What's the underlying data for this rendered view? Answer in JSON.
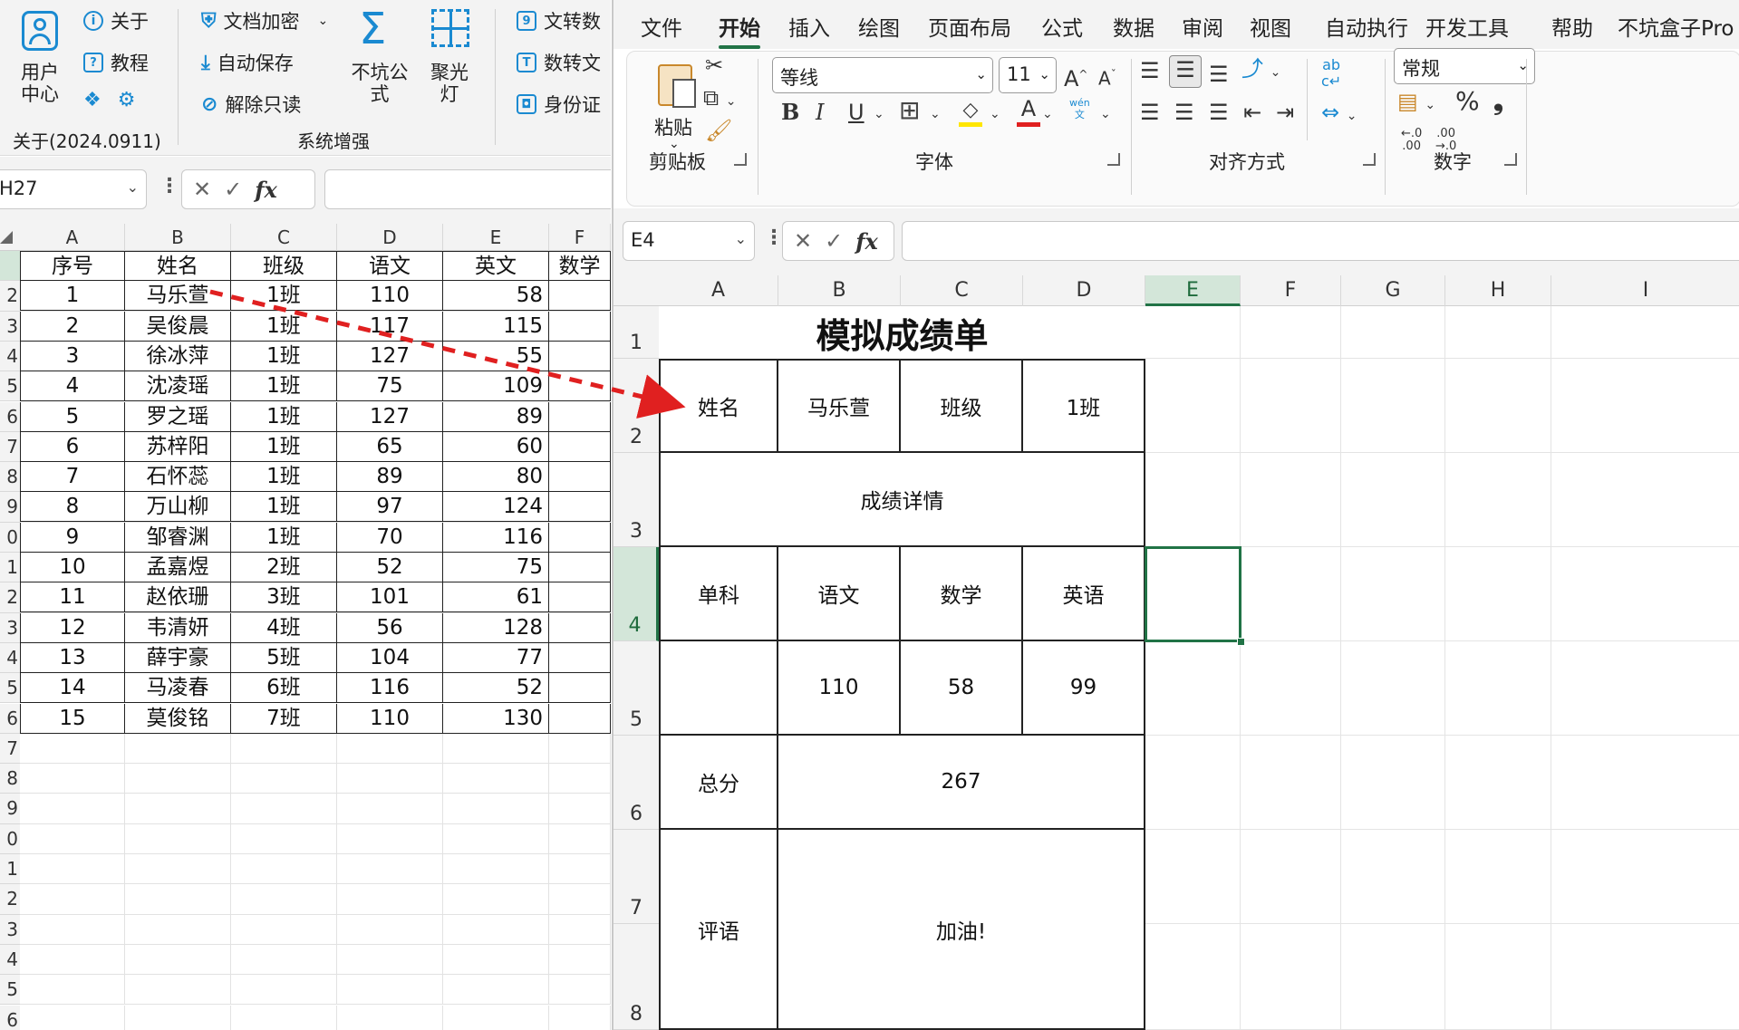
{
  "left_window": {
    "ribbon": {
      "user_center": "用户\n中心",
      "about": "关于",
      "tutorial": "教程",
      "doc_encrypt": "文档加密",
      "auto_save": "自动保存",
      "unlock_readonly": "解除只读",
      "bukeng_formula": "不坑公\n式",
      "spotlight": "聚光\n灯",
      "text_convert": "文转数",
      "num_convert": "数转文",
      "id_card": "身份证",
      "version_label": "关于(2024.0911)",
      "system_group": "系统增强"
    },
    "name_box": "H27",
    "column_headers": [
      "A",
      "B",
      "C",
      "D",
      "E",
      "F"
    ],
    "row_numbers": [
      "2",
      "3",
      "4",
      "5",
      "6",
      "7",
      "8",
      "9",
      "0",
      "1",
      "2",
      "3",
      "4",
      "5",
      "6",
      "7",
      "8",
      "9",
      "0",
      "1",
      "2",
      "3",
      "4",
      "5",
      "6"
    ],
    "table_headers": [
      "序号",
      "姓名",
      "班级",
      "语文",
      "英文",
      "数学"
    ],
    "rows": [
      [
        "1",
        "马乐萱",
        "1班",
        "110",
        "58"
      ],
      [
        "2",
        "吴俊晨",
        "1班",
        "117",
        "115"
      ],
      [
        "3",
        "徐冰萍",
        "1班",
        "127",
        "55"
      ],
      [
        "4",
        "沈凌瑶",
        "1班",
        "75",
        "109"
      ],
      [
        "5",
        "罗之瑶",
        "1班",
        "127",
        "89"
      ],
      [
        "6",
        "苏梓阳",
        "1班",
        "65",
        "60"
      ],
      [
        "7",
        "石怀蕊",
        "1班",
        "89",
        "80"
      ],
      [
        "8",
        "万山柳",
        "1班",
        "97",
        "124"
      ],
      [
        "9",
        "邹睿渊",
        "1班",
        "70",
        "116"
      ],
      [
        "10",
        "孟嘉煜",
        "2班",
        "52",
        "75"
      ],
      [
        "11",
        "赵依珊",
        "3班",
        "101",
        "61"
      ],
      [
        "12",
        "韦清妍",
        "4班",
        "56",
        "128"
      ],
      [
        "13",
        "薛宇豪",
        "5班",
        "104",
        "77"
      ],
      [
        "14",
        "马凌春",
        "6班",
        "116",
        "52"
      ],
      [
        "15",
        "莫俊铭",
        "7班",
        "110",
        "130"
      ]
    ]
  },
  "right_window": {
    "menu_tabs": [
      "文件",
      "开始",
      "插入",
      "绘图",
      "页面布局",
      "公式",
      "数据",
      "审阅",
      "视图",
      "自动执行",
      "开发工具",
      "帮助",
      "不坑盒子Pro"
    ],
    "active_tab": "开始",
    "ribbon": {
      "paste": "粘贴",
      "clipboard_group": "剪贴板",
      "font_name": "等线",
      "font_size": "11",
      "font_group": "字体",
      "align_group": "对齐方式",
      "number_format": "常规",
      "number_group": "数字",
      "bold": "B",
      "italic": "I",
      "underline": "U",
      "percent": "%",
      "comma": "❟",
      "wen": "wén\n文",
      "dec_inc": "←.0\n.00",
      "dec_dec": ".00\n→.0"
    },
    "name_box": "E4",
    "column_headers": [
      "A",
      "B",
      "C",
      "D",
      "E",
      "F",
      "G",
      "H",
      "I"
    ],
    "row_numbers": [
      "1",
      "2",
      "3",
      "4",
      "5",
      "6",
      "7",
      "8"
    ],
    "selected_cell": "E4",
    "report": {
      "title": "模拟成绩单",
      "name_label": "姓名",
      "name_value": "马乐萱",
      "class_label": "班级",
      "class_value": "1班",
      "details_label": "成绩详情",
      "subject_label": "单科",
      "subjects": [
        "语文",
        "数学",
        "英语"
      ],
      "scores": [
        "110",
        "58",
        "99"
      ],
      "total_label": "总分",
      "total_value": "267",
      "comment_label": "评语",
      "comment_value": "加油!"
    }
  },
  "colors": {
    "accent_green": "#217346",
    "arrow_red": "#e02020",
    "icon_blue": "#1a8ad1"
  }
}
